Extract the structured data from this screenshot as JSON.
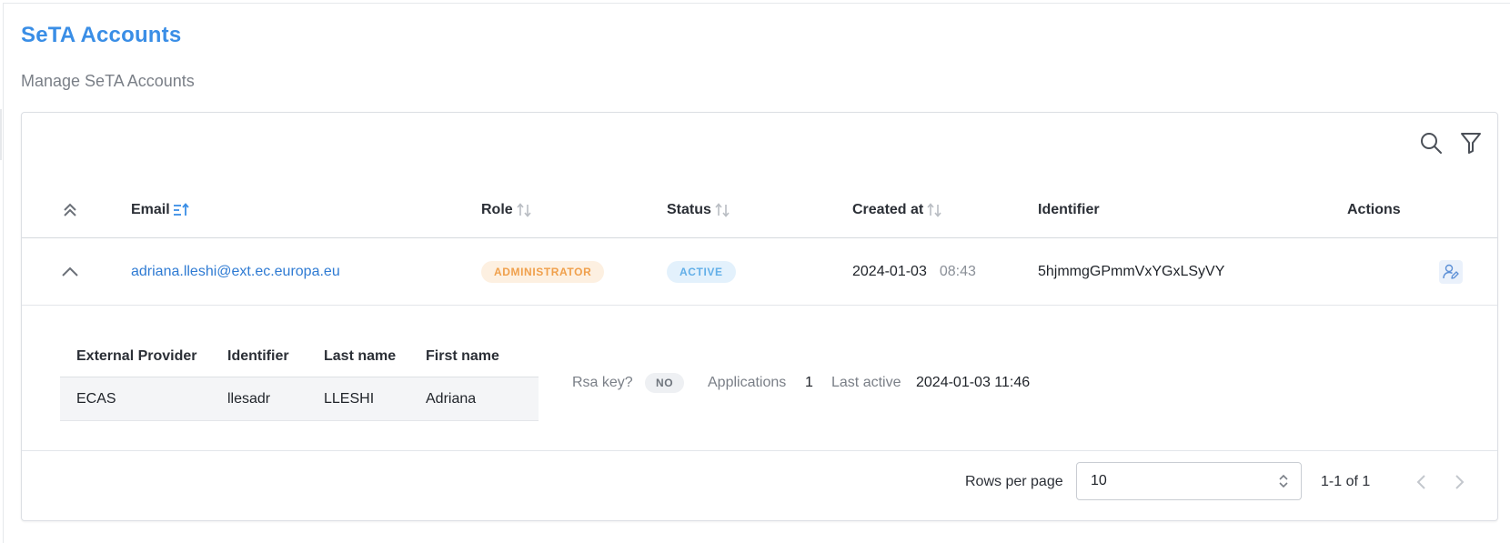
{
  "page": {
    "title": "SeTA Accounts",
    "subtitle": "Manage SeTA Accounts"
  },
  "toolbar": {
    "search_icon": "search-icon",
    "filter_icon": "filter-icon"
  },
  "table": {
    "columns": [
      {
        "label": "Email",
        "sort": "ascending"
      },
      {
        "label": "Role",
        "sort": "none"
      },
      {
        "label": "Status",
        "sort": "none"
      },
      {
        "label": "Created at",
        "sort": "none"
      },
      {
        "label": "Identifier",
        "sort": "none"
      },
      {
        "label": "Actions",
        "sort": "none"
      }
    ],
    "rows": [
      {
        "email": "adriana.lleshi@ext.ec.europa.eu",
        "role": "ADMINISTRATOR",
        "status": "ACTIVE",
        "created_date": "2024-01-03",
        "created_time": "08:43",
        "identifier": "5hjmmgGPmmVxYGxLSyVY",
        "expanded": true,
        "detail": {
          "providers_columns": [
            "External Provider",
            "Identifier",
            "Last name",
            "First name"
          ],
          "providers": [
            {
              "provider": "ECAS",
              "identifier": "llesadr",
              "last_name": "LLESHI",
              "first_name": "Adriana"
            }
          ],
          "rsa_key_label": "Rsa key?",
          "rsa_key_value": "NO",
          "applications_label": "Applications",
          "applications_value": "1",
          "last_active_label": "Last active",
          "last_active_value": "2024-01-03 11:46"
        }
      }
    ]
  },
  "pagination": {
    "rows_per_page_label": "Rows per page",
    "rows_per_page_value": "10",
    "range_text": "1-1 of 1"
  },
  "colors": {
    "accent": "#3a8ee6",
    "link": "#2f7bd3",
    "admin_chip_bg": "#fdf0e1",
    "admin_chip_text": "#f0a04c",
    "active_chip_bg": "#e3f1fc",
    "active_chip_text": "#62afe8"
  }
}
